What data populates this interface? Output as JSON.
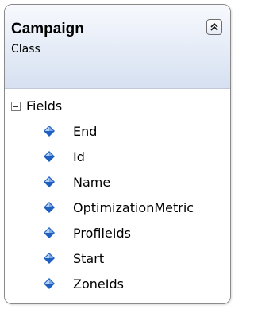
{
  "class": {
    "name": "Campaign",
    "stereotype": "Class",
    "collapse_icon": "double-chevron-up-icon"
  },
  "compartment": {
    "title": "Fields",
    "toggle_icon": "minus-box-icon",
    "field_icon": "field-diamond-icon",
    "fields": [
      {
        "label": "End"
      },
      {
        "label": "Id"
      },
      {
        "label": "Name"
      },
      {
        "label": "OptimizationMetric"
      },
      {
        "label": "ProfileIds"
      },
      {
        "label": "Start"
      },
      {
        "label": "ZoneIds"
      }
    ]
  },
  "colors": {
    "header_top": "#f7f9fd",
    "header_bottom": "#d6e0f1",
    "border": "#8a8a8a",
    "field_icon_light": "#8fb8f0",
    "field_icon_dark": "#1f5fbf"
  }
}
